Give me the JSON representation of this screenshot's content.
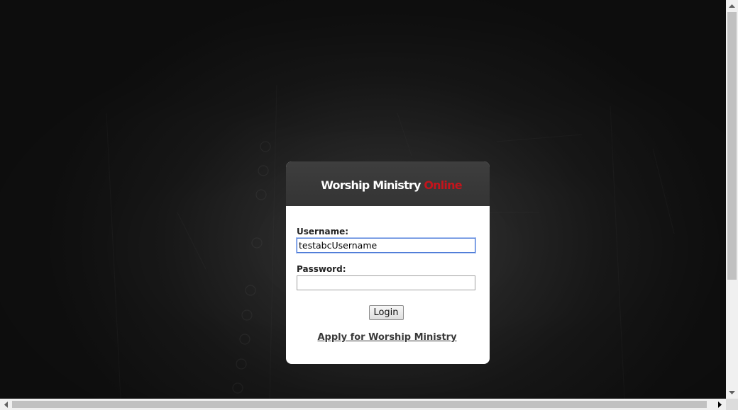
{
  "header": {
    "logo_main": "Worship Ministry ",
    "logo_accent": "Online"
  },
  "form": {
    "username_label": "Username:",
    "username_value": "testabcUsername",
    "password_label": "Password:",
    "password_value": "",
    "login_label": "Login",
    "apply_link": "Apply for Worship Ministry"
  },
  "colors": {
    "accent": "#c4141c",
    "header_bg": "#3a3a3a",
    "background": "#1a1a1a"
  }
}
